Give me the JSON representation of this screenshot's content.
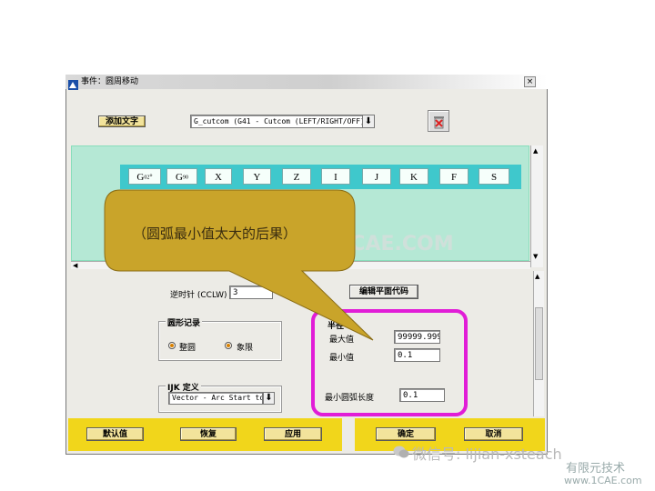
{
  "window": {
    "title": "事件：圆周移动"
  },
  "toolbar": {
    "add_text_button": "添加文字",
    "command_select_value": "G_cutcom (G41 - Cutcom (LEFT/RIGHT/OFF))"
  },
  "tokens": [
    "G02°",
    "G90",
    "X",
    "Y",
    "Z",
    "I",
    "J",
    "K",
    "F",
    "S"
  ],
  "token_parts": {
    "g02_main": "G",
    "g02_sub": "02",
    "g02_deg": "°",
    "g90_main": "G",
    "g90_sub": "90"
  },
  "callout": {
    "text": "（圆弧最小值太大的后果）"
  },
  "form": {
    "ccw_label": "逆时针 (CCLW)",
    "ccw_value": "3",
    "edit_plane_button": "编辑平面代码",
    "circle_record_title": "圆形记录",
    "circle_full_label": "整圆",
    "circle_quadrant_label": "象限",
    "ijk_title": "IJK 定义",
    "ijk_select_value": "Vector - Arc Start to",
    "radius_title": "半径",
    "max_label": "最大值",
    "max_value": "99999.999",
    "min_label": "最小值",
    "min_value": "0.1",
    "min_arc_label": "最小圆弧长度",
    "min_arc_value": "0.1"
  },
  "footer": {
    "default_button": "默认值",
    "restore_button": "恢复",
    "apply_button": "应用",
    "ok_button": "确定",
    "cancel_button": "取消"
  },
  "watermarks": {
    "center": "1CAE.COM",
    "wechat": "微信号: lijian-xsteach",
    "corner_line1": "有限元技术",
    "corner_line2": "www.1CAE.com"
  },
  "colors": {
    "token_bar": "#3fc8cc",
    "panel_green": "#b5e8d5",
    "button_yellow": "#f2e39b",
    "footer_yellow": "#f1d61b",
    "callout_fill": "#c9a42a",
    "highlight": "#e11dd7"
  },
  "icons": {
    "recycle": "trash-icon",
    "dropdown": "chevron-down-icon",
    "wechat": "wechat-icon"
  }
}
